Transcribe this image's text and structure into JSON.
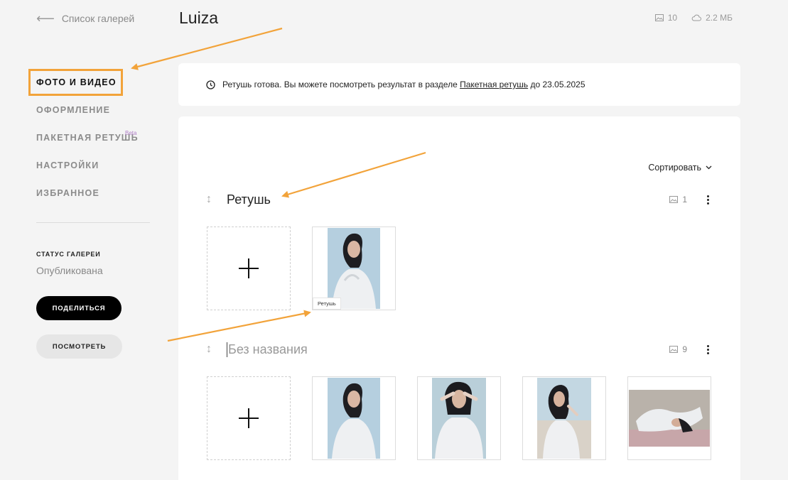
{
  "header": {
    "back_label": "Список галерей",
    "gallery_title": "Luiza",
    "photo_count": "10",
    "storage": "2.2 МБ"
  },
  "sidebar": {
    "items": [
      {
        "label": "ФОТО И ВИДЕО",
        "active": true
      },
      {
        "label": "ОФОРМЛЕНИЕ"
      },
      {
        "label": "ПАКЕТНАЯ РЕТУШЬ",
        "badge": "Beta"
      },
      {
        "label": "НАСТРОЙКИ"
      },
      {
        "label": "ИЗБРАННОЕ"
      }
    ],
    "status_label": "СТАТУС ГАЛЕРЕИ",
    "status_value": "Опубликована",
    "share_button": "ПОДЕЛИТЬСЯ",
    "view_button": "ПОСМОТРЕТЬ"
  },
  "notice": {
    "text_before": "Ретушь готова. Вы можете посмотреть результат в разделе ",
    "link": "Пакетная ретушь",
    "text_after": " до 23.05.2025"
  },
  "main": {
    "sort_label": "Сортировать",
    "albums": [
      {
        "title": "Ретушь",
        "count": "1",
        "photos": [
          {
            "tag": "Ретушь"
          }
        ]
      },
      {
        "title": "Без названия",
        "count": "9",
        "photos": [
          {},
          {},
          {},
          {}
        ]
      }
    ]
  },
  "colors": {
    "accent_arrow": "#f2a33a",
    "beta": "#b07fc7"
  }
}
